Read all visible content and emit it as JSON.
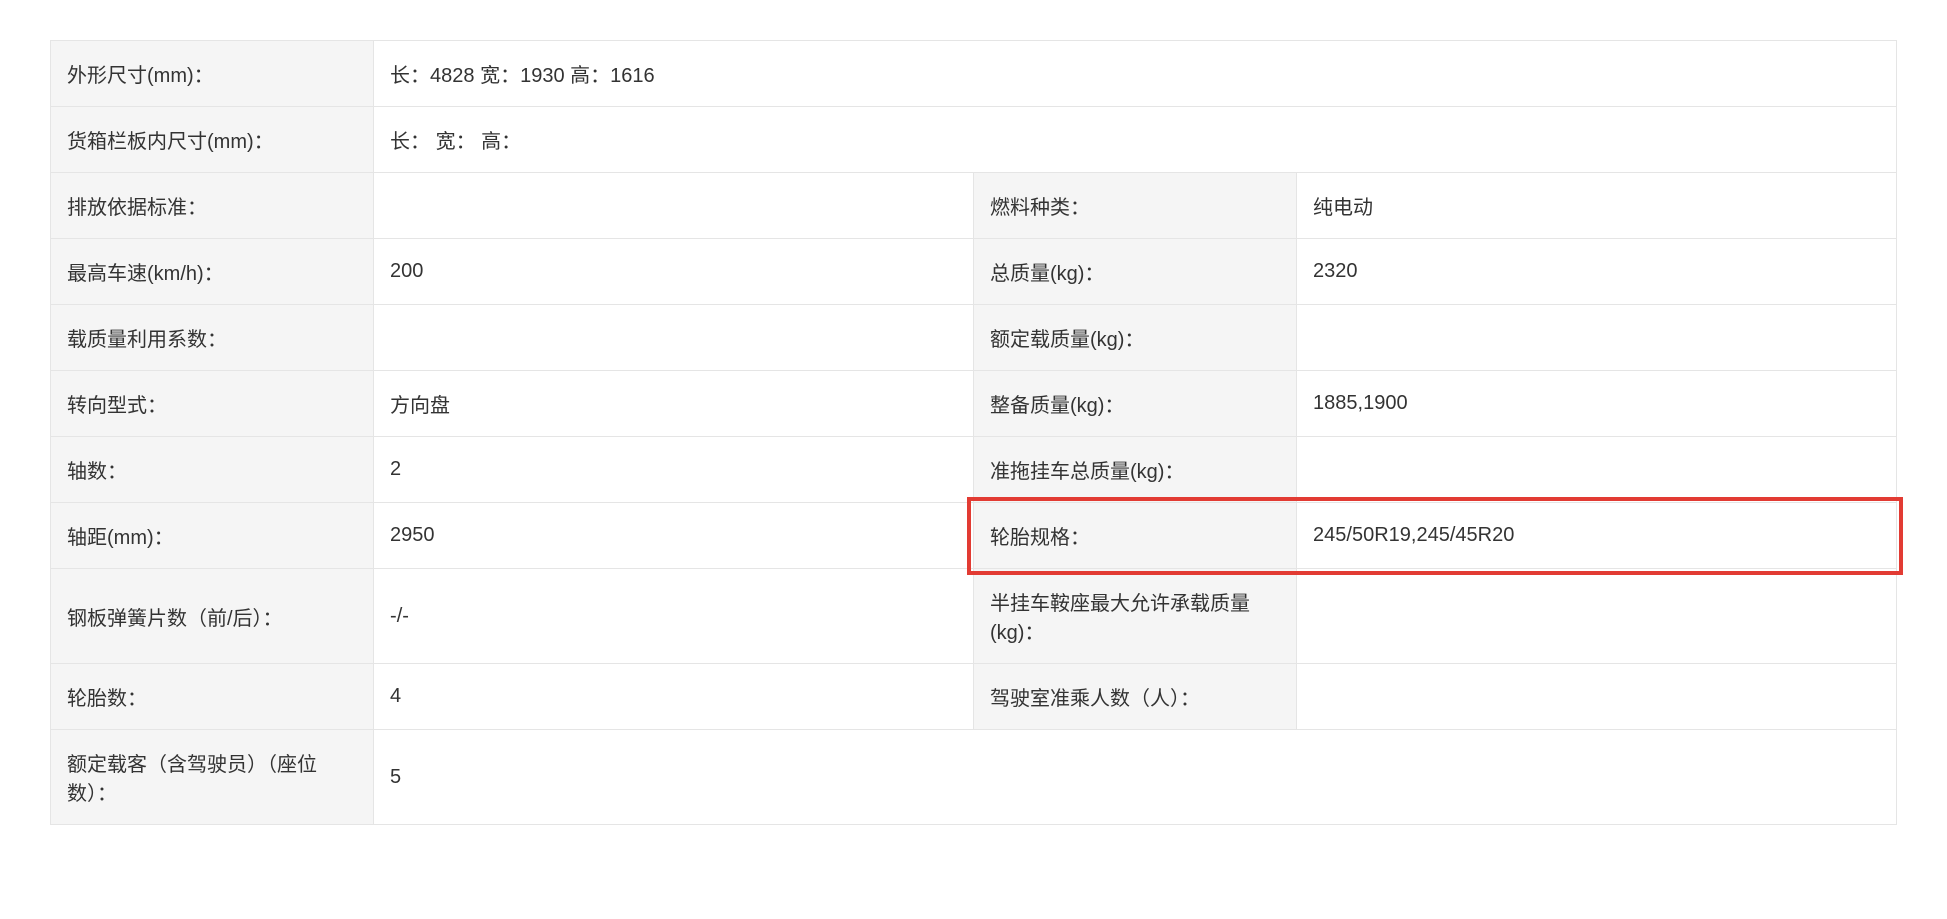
{
  "rows": {
    "dimensions_label": "外形尺寸(mm)：",
    "dimensions_value": "长：4828 宽：1930 高：1616",
    "cargo_box_label": "货箱栏板内尺寸(mm)：",
    "cargo_box_value": "长： 宽： 高：",
    "emission_label": "排放依据标准：",
    "emission_value": "",
    "fuel_label": "燃料种类：",
    "fuel_value": "纯电动",
    "top_speed_label": "最高车速(km/h)：",
    "top_speed_value": "200",
    "gross_weight_label": "总质量(kg)：",
    "gross_weight_value": "2320",
    "load_coef_label": "载质量利用系数：",
    "load_coef_value": "",
    "rated_load_label": "额定载质量(kg)：",
    "rated_load_value": "",
    "steering_label": "转向型式：",
    "steering_value": "方向盘",
    "curb_weight_label": "整备质量(kg)：",
    "curb_weight_value": "1885,1900",
    "axles_label": "轴数：",
    "axles_value": "2",
    "trailer_gross_label": "准拖挂车总质量(kg)：",
    "trailer_gross_value": "",
    "wheelbase_label": "轴距(mm)：",
    "wheelbase_value": "2950",
    "tire_spec_label": "轮胎规格：",
    "tire_spec_value": "245/50R19,245/45R20",
    "leaf_spring_label": "钢板弹簧片数（前/后）：",
    "leaf_spring_value": "-/-",
    "saddle_max_label": "半挂车鞍座最大允许承载质量(kg)：",
    "saddle_max_value": "",
    "tire_count_label": "轮胎数：",
    "tire_count_value": "4",
    "cab_occupants_label": "驾驶室准乘人数（人）：",
    "cab_occupants_value": "",
    "rated_passengers_label": "额定载客（含驾驶员）（座位数）：",
    "rated_passengers_value": "5"
  }
}
